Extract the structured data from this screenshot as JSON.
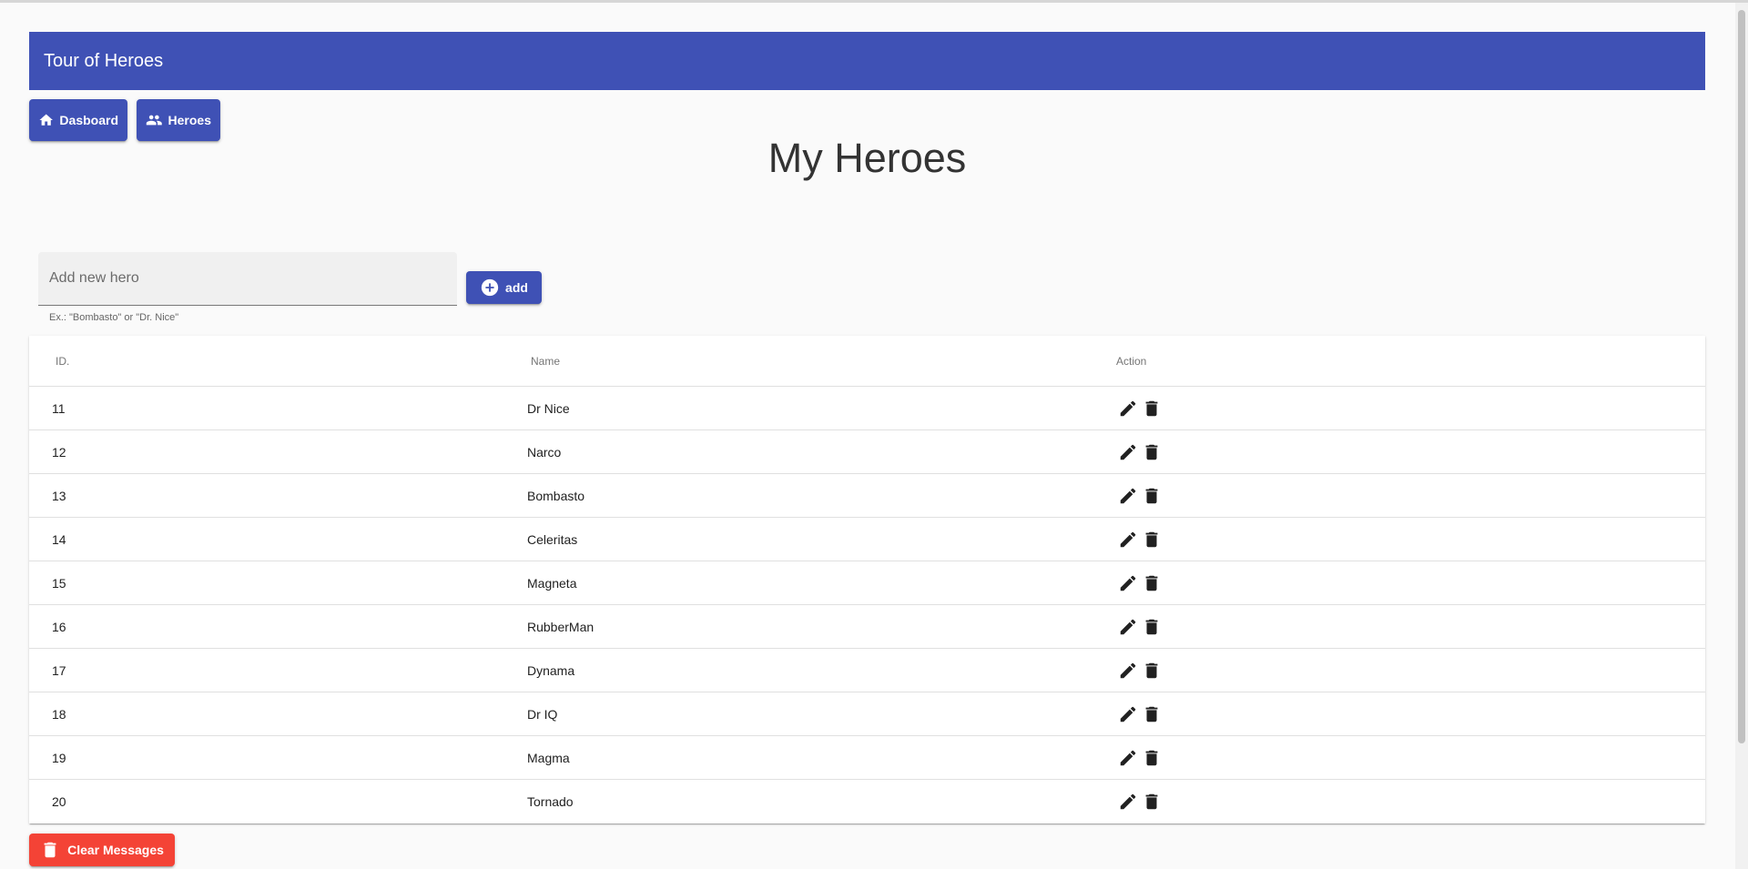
{
  "app": {
    "title": "Tour of Heroes"
  },
  "nav": {
    "dashboard_label": "Dasboard",
    "heroes_label": "Heroes"
  },
  "page": {
    "title": "My Heroes"
  },
  "add_form": {
    "placeholder": "Add new hero",
    "hint": "Ex.: \"Bombasto\" or \"Dr. Nice\"",
    "button_label": "add"
  },
  "table": {
    "headers": {
      "id": "ID.",
      "name": "Name",
      "action": "Action"
    },
    "rows": [
      {
        "id": "11",
        "name": "Dr Nice"
      },
      {
        "id": "12",
        "name": "Narco"
      },
      {
        "id": "13",
        "name": "Bombasto"
      },
      {
        "id": "14",
        "name": "Celeritas"
      },
      {
        "id": "15",
        "name": "Magneta"
      },
      {
        "id": "16",
        "name": "RubberMan"
      },
      {
        "id": "17",
        "name": "Dynama"
      },
      {
        "id": "18",
        "name": "Dr IQ"
      },
      {
        "id": "19",
        "name": "Magma"
      },
      {
        "id": "20",
        "name": "Tornado"
      }
    ],
    "row_icons": [
      "edit-icon",
      "delete-icon"
    ]
  },
  "messages": {
    "clear_label": "Clear Messages"
  },
  "colors": {
    "primary": "#3f51b5",
    "warn": "#f44336",
    "background": "#fafafa"
  }
}
